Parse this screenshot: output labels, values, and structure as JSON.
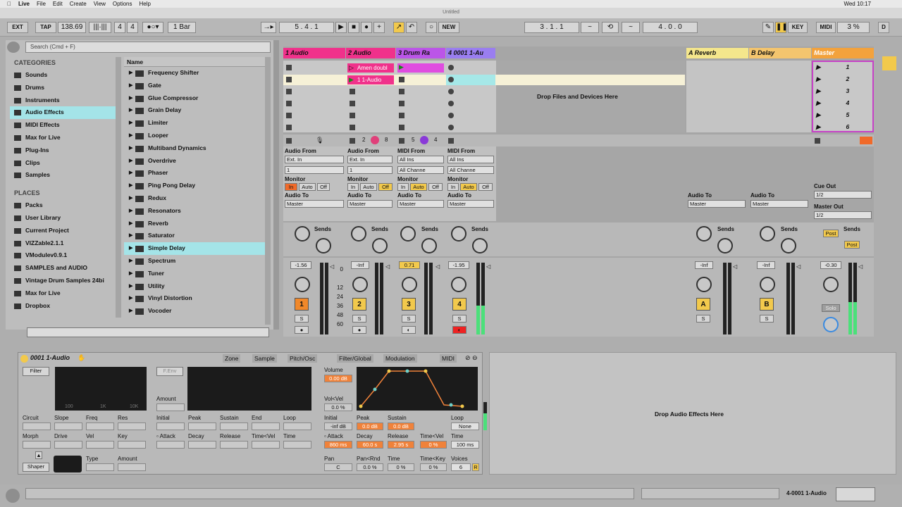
{
  "menubar": {
    "apple": "",
    "app": "Live",
    "file": "File",
    "edit": "Edit",
    "create": "Create",
    "view": "View",
    "options": "Options",
    "help": "Help",
    "time": "Wed 10:17"
  },
  "window": {
    "title": "Untitled"
  },
  "transport": {
    "ext": "EXT",
    "tap": "TAP",
    "tempo": "138.69",
    "sig_num": "4",
    "sig_den": "4",
    "quant": "1 Bar",
    "arr_pos": "5 .   4 .   1",
    "new": "NEW",
    "loop_start": "3 .   1 .   1",
    "loop_len": "4 .   0 .   0",
    "key": "KEY",
    "midi": "MIDI",
    "cpu": "3 %",
    "d": "D"
  },
  "browser": {
    "search_placeholder": "Search (Cmd + F)",
    "categories_title": "CATEGORIES",
    "categories": [
      "Sounds",
      "Drums",
      "Instruments",
      "Audio Effects",
      "MIDI Effects",
      "Max for Live",
      "Plug-Ins",
      "Clips",
      "Samples"
    ],
    "places_title": "PLACES",
    "places": [
      "Packs",
      "User Library",
      "Current Project",
      "VIZZable2.1.1",
      "VModulev0.9.1",
      "SAMPLES and AUDIO",
      "Vintage Drum Samples 24bi",
      "Max for Live",
      "Dropbox"
    ],
    "name_header": "Name",
    "items": [
      "Frequency Shifter",
      "Gate",
      "Glue Compressor",
      "Grain Delay",
      "Limiter",
      "Looper",
      "Multiband Dynamics",
      "Overdrive",
      "Phaser",
      "Ping Pong Delay",
      "Redux",
      "Resonators",
      "Reverb",
      "Saturator",
      "Simple Delay",
      "Spectrum",
      "Tuner",
      "Utility",
      "Vinyl Distortion",
      "Vocoder"
    ]
  },
  "session": {
    "tracks": [
      {
        "name": "1 Audio",
        "color": "#f0318b",
        "vol": "-1.56",
        "num": "1",
        "from": "Audio From",
        "in1": "Ext. In",
        "in2": "1",
        "to": "Master"
      },
      {
        "name": "2 Audio",
        "color": "#f0318b",
        "vol": "-Inf",
        "num": "2",
        "from": "Audio From",
        "in1": "Ext. In",
        "in2": "1",
        "to": "Master"
      },
      {
        "name": "3 Drum Ra",
        "color": "#bb55e8",
        "vol": "0.71",
        "num": "3",
        "from": "MIDI From",
        "in1": "All Ins",
        "in2": "All Channe",
        "to": "Master"
      },
      {
        "name": "4 0001 1-Au",
        "color": "#9a7ef0",
        "vol": "-1.95",
        "num": "4",
        "from": "MIDI From",
        "in1": "All Ins",
        "in2": "All Channe",
        "to": "Master"
      }
    ],
    "clips": {
      "amen": "Amen doubl",
      "clip1": "1 1-Audio"
    },
    "drop_text": "Drop Files and Devices Here",
    "returns": [
      {
        "name": "A Reverb",
        "vol": "-Inf",
        "btn": "A"
      },
      {
        "name": "B Delay",
        "vol": "-Inf",
        "btn": "B"
      }
    ],
    "master": {
      "name": "Master",
      "vol": "-0.30",
      "scenes": [
        "1",
        "2",
        "3",
        "4",
        "5",
        "6"
      ],
      "cue_out": "Cue Out",
      "cue_val": "1/2",
      "master_out": "Master Out",
      "master_val": "1/2",
      "post": "Post",
      "solo": "Solo"
    },
    "monitor": "Monitor",
    "audio_to": "Audio To",
    "sends": "Sends",
    "in": "In",
    "auto": "Auto",
    "off": "Off",
    "s": "S",
    "scale": [
      "0",
      "12",
      "24",
      "36",
      "48",
      "60"
    ],
    "num2": "2",
    "num8": "8",
    "num5": "5",
    "num4": "4"
  },
  "device": {
    "title": "0001 1-Audio",
    "tabs": [
      "Zone",
      "Sample",
      "Pitch/Osc",
      "Filter/Global",
      "Modulation",
      "MIDI"
    ],
    "filter": "Filter",
    "fenv": "F.Env",
    "amount": "Amount",
    "freq_ticks": [
      "100",
      "1K",
      "10K"
    ],
    "labels": {
      "circuit": "Circuit",
      "slope": "Slope",
      "freq": "Freq",
      "res": "Res",
      "morph": "Morph",
      "drive": "Drive",
      "vel": "Vel",
      "key": "Key",
      "initial": "Initial",
      "peak": "Peak",
      "sustain": "Sustain",
      "end": "End",
      "loop": "Loop",
      "attack": "Attack",
      "decay": "Decay",
      "release": "Release",
      "timevel": "Time<Vel",
      "time": "Time",
      "shaper": "Shaper",
      "type": "Type",
      "amount2": "Amount"
    },
    "amp": {
      "volume": "Volume",
      "volume_val": "0.00 dB",
      "volvel": "Vol<Vel",
      "volvel_val": "0.0 %",
      "initial": "Initial",
      "initial_val": "-inf dB",
      "peak": "Peak",
      "peak_val": "0.0 dB",
      "sustain": "Sustain",
      "sustain_val": "0.0 dB",
      "loop": "Loop",
      "loop_val": "None",
      "attack": "Attack",
      "attack_val": "860 ms",
      "decay": "Decay",
      "decay_val": "60.0 s",
      "release": "Release",
      "release_val": "2.95 s",
      "timevel": "Time<Vel",
      "timevel_val": "0 %",
      "time": "Time",
      "time_val": "100 ms",
      "pan": "Pan",
      "pan_val": "C",
      "panrnd": "Pan<Rnd",
      "panrnd_val": "0.0 %",
      "time2": "Time",
      "time2_val": "0 %",
      "timekey": "Time<Key",
      "timekey_val": "0 %",
      "voices": "Voices",
      "voices_val": "6",
      "r": "R"
    }
  },
  "fx_drop": "Drop Audio Effects Here",
  "status": {
    "track": "4-0001 1-Audio"
  }
}
